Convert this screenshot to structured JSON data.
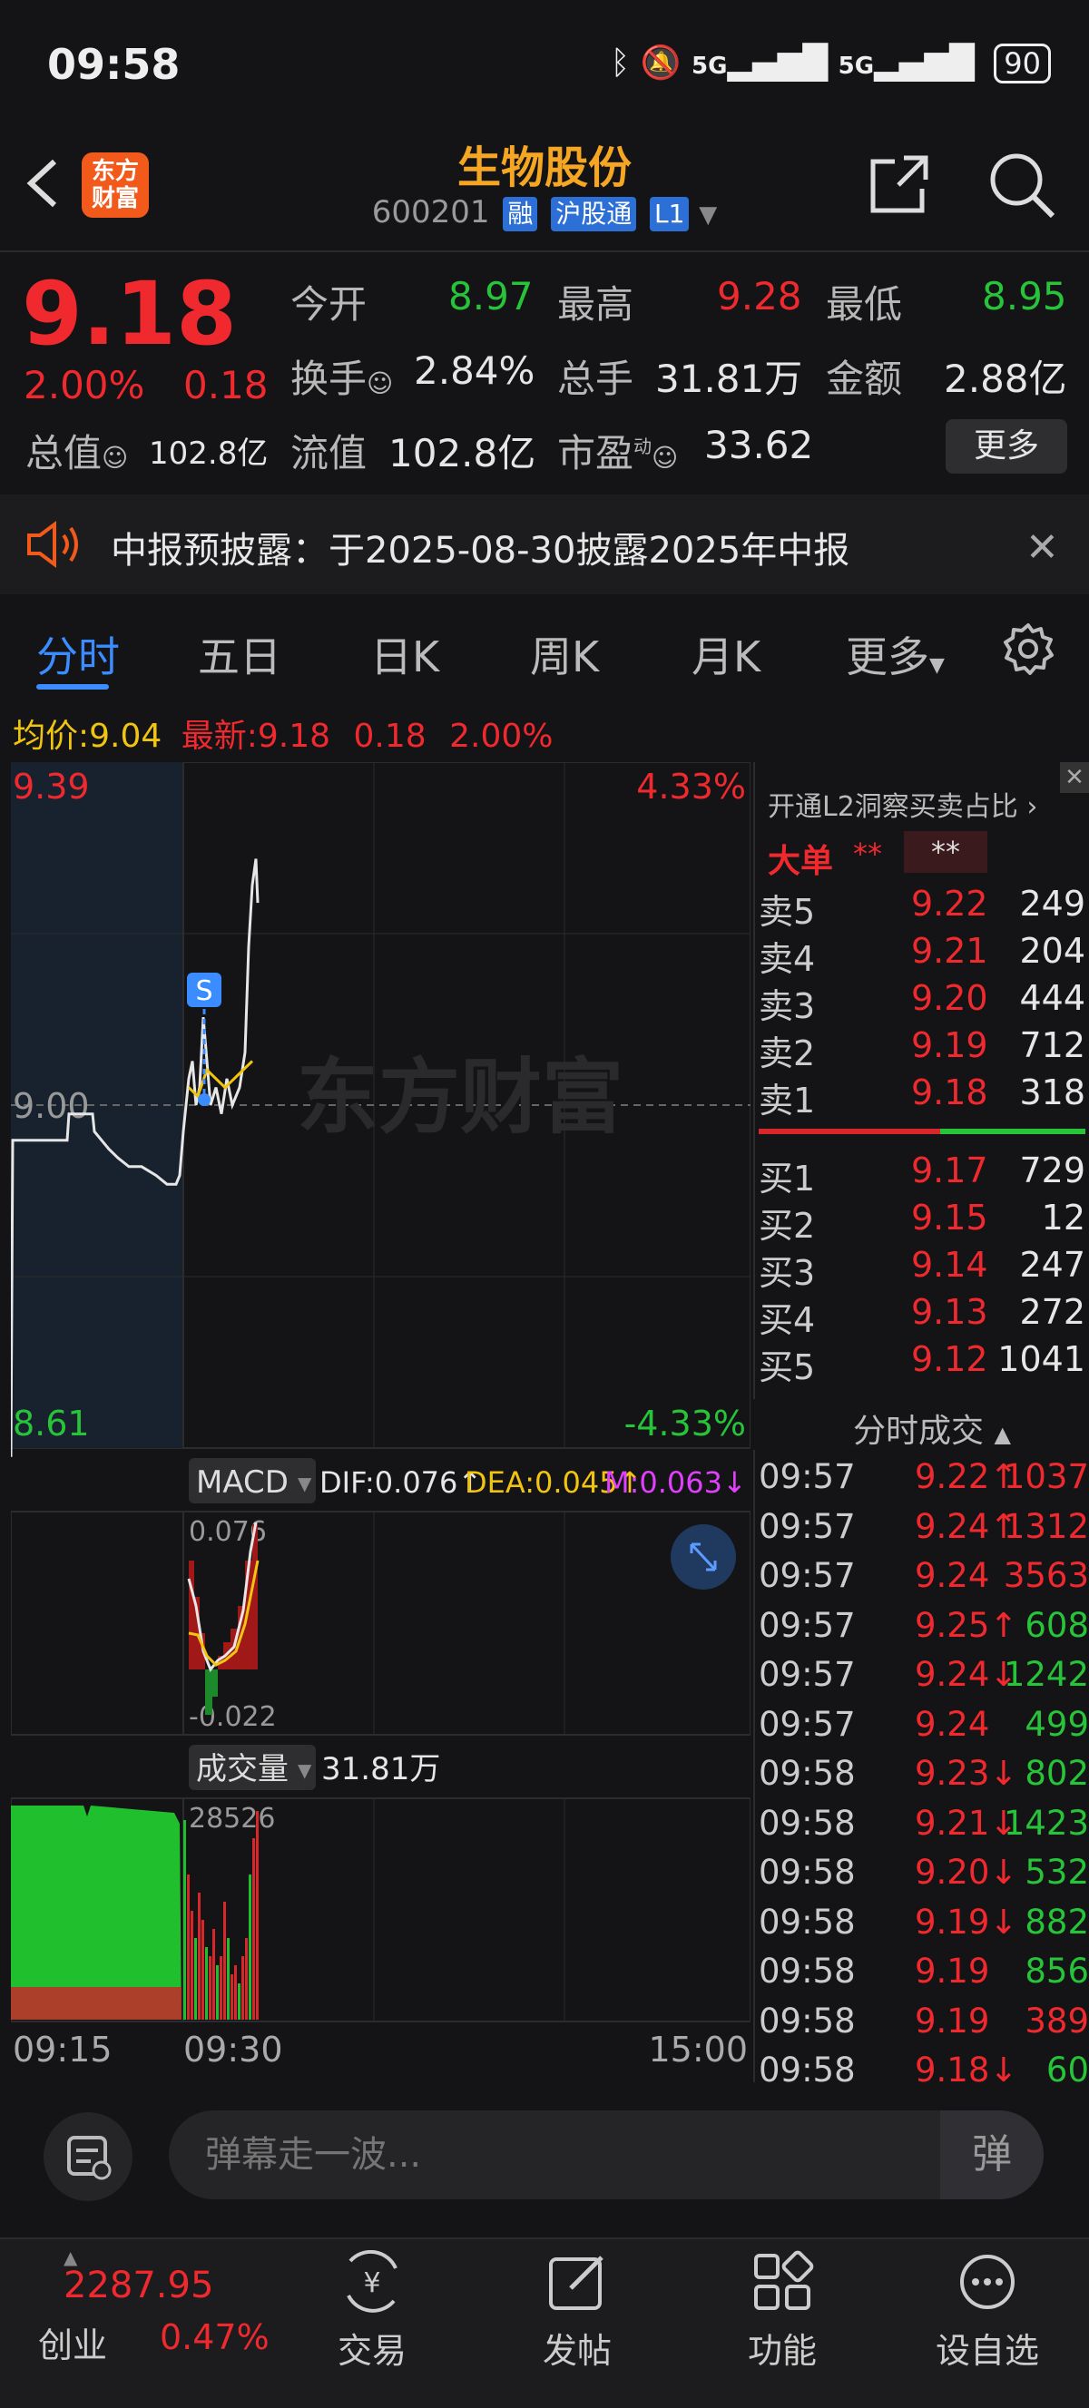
{
  "status": {
    "time": "09:58",
    "battery": "90",
    "net1": "5G",
    "net2": "5G"
  },
  "header": {
    "logo_line1": "东方",
    "logo_line2": "财富",
    "name": "生物股份",
    "code": "600201",
    "tags": [
      "融",
      "沪股通",
      "L1"
    ]
  },
  "quote": {
    "price": "9.18",
    "change_pct": "2.00%",
    "change_abs": "0.18",
    "fields": [
      {
        "label": "今开",
        "value": "8.97",
        "color": "green"
      },
      {
        "label": "最高",
        "value": "9.28",
        "color": "red"
      },
      {
        "label": "最低",
        "value": "8.95",
        "color": "green"
      },
      {
        "label": "换手",
        "value": "2.84%",
        "color": "white"
      },
      {
        "label": "总手",
        "value": "31.81万",
        "color": "white"
      },
      {
        "label": "金额",
        "value": "2.88亿",
        "color": "white"
      },
      {
        "label": "总值",
        "value": "102.8亿",
        "color": "white"
      },
      {
        "label": "流值",
        "value": "102.8亿",
        "color": "white"
      },
      {
        "label": "市盈",
        "value": "33.62",
        "color": "white"
      }
    ],
    "pe_sup": "动",
    "more_label": "更多"
  },
  "notice": {
    "text": "中报预披露：于2025-08-30披露2025年中报"
  },
  "tabs": [
    "分时",
    "五日",
    "日K",
    "周K",
    "月K",
    "更多"
  ],
  "avg_line": {
    "avg_label": "均价:",
    "avg_value": "9.04",
    "latest_label": "最新:",
    "latest_value": "9.18",
    "chg": "0.18",
    "pct": "2.00%"
  },
  "chart": {
    "price_high": "9.39",
    "price_mid": "9.00",
    "price_low": "8.61",
    "pct_high": "4.33%",
    "pct_low": "-4.33%",
    "watermark": "东方财富",
    "marker": "S",
    "macd_label": "MACD",
    "dif": "DIF:0.076↑",
    "dea": "DEA:0.045↑",
    "m": "M:0.063↓",
    "macd_high": "0.076",
    "macd_low": "-0.022",
    "vol_label": "成交量",
    "vol_total": "31.81万",
    "vol_peak": "28526",
    "times": [
      "09:15",
      "09:30",
      "15:00"
    ]
  },
  "chart_data": {
    "type": "line",
    "title": "",
    "xlabel": "",
    "ylabel": "",
    "ylim": [
      8.61,
      9.39
    ],
    "x": [
      "09:15",
      "09:20",
      "09:25",
      "09:30",
      "09:35",
      "09:40",
      "09:45",
      "09:50",
      "09:55",
      "09:58"
    ],
    "series": [
      {
        "name": "",
        "values": [
          8.95,
          8.96,
          8.96,
          8.97,
          8.96,
          8.92,
          8.99,
          9.05,
          9.02,
          9.18
        ]
      },
      {
        "name": "均价",
        "values": [
          8.96,
          8.96,
          8.96,
          8.96,
          8.96,
          8.96,
          8.98,
          9.01,
          9.03,
          9.04
        ]
      }
    ]
  },
  "orderbook": {
    "title": "开通L2洞察买卖占比",
    "big_label": "大单",
    "big_a": "**",
    "big_b": "**",
    "sells": [
      {
        "label": "卖5",
        "price": "9.22",
        "vol": "249"
      },
      {
        "label": "卖4",
        "price": "9.21",
        "vol": "204"
      },
      {
        "label": "卖3",
        "price": "9.20",
        "vol": "444"
      },
      {
        "label": "卖2",
        "price": "9.19",
        "vol": "712"
      },
      {
        "label": "卖1",
        "price": "9.18",
        "vol": "318"
      }
    ],
    "buys": [
      {
        "label": "买1",
        "price": "9.17",
        "vol": "729"
      },
      {
        "label": "买2",
        "price": "9.15",
        "vol": "12"
      },
      {
        "label": "买3",
        "price": "9.14",
        "vol": "247"
      },
      {
        "label": "买4",
        "price": "9.13",
        "vol": "272"
      },
      {
        "label": "买5",
        "price": "9.12",
        "vol": "1041"
      }
    ],
    "trades_title": "分时成交",
    "trades": [
      {
        "time": "09:57",
        "price": "9.22↑",
        "vol": "1037",
        "vcolor": "red"
      },
      {
        "time": "09:57",
        "price": "9.24↑",
        "vol": "1312",
        "vcolor": "red"
      },
      {
        "time": "09:57",
        "price": "9.24",
        "vol": "3563",
        "vcolor": "red"
      },
      {
        "time": "09:57",
        "price": "9.25↑",
        "vol": "608",
        "vcolor": "green"
      },
      {
        "time": "09:57",
        "price": "9.24↓",
        "vol": "1242",
        "vcolor": "green"
      },
      {
        "time": "09:57",
        "price": "9.24",
        "vol": "499",
        "vcolor": "green"
      },
      {
        "time": "09:58",
        "price": "9.23↓",
        "vol": "802",
        "vcolor": "green"
      },
      {
        "time": "09:58",
        "price": "9.21↓",
        "vol": "1423",
        "vcolor": "green"
      },
      {
        "time": "09:58",
        "price": "9.20↓",
        "vol": "532",
        "vcolor": "green"
      },
      {
        "time": "09:58",
        "price": "9.19↓",
        "vol": "882",
        "vcolor": "green"
      },
      {
        "time": "09:58",
        "price": "9.19",
        "vol": "856",
        "vcolor": "green"
      },
      {
        "time": "09:58",
        "price": "9.19",
        "vol": "389",
        "vcolor": "red"
      },
      {
        "time": "09:58",
        "price": "9.18↓",
        "vol": "60",
        "vcolor": "green"
      }
    ]
  },
  "bottom": {
    "placeholder": "弹幕走一波...",
    "danmu_btn": "弹"
  },
  "tabbar": {
    "index_value": "2287.95",
    "index_name": "创业",
    "index_pct": "0.47%",
    "items": [
      "交易",
      "发帖",
      "功能",
      "设自选"
    ]
  }
}
